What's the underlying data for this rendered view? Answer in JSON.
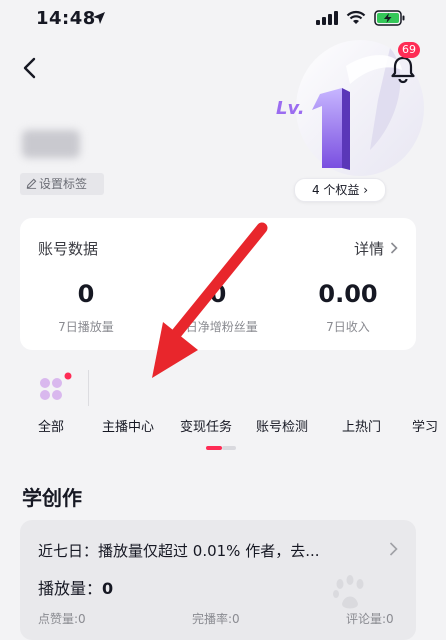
{
  "status_bar": {
    "time": "14:48"
  },
  "header": {
    "notification_count": "69"
  },
  "level": {
    "label": "Lv.",
    "number": "1",
    "benefits_label": "4 个权益 ›"
  },
  "profile": {
    "set_tag_label": "设置标签"
  },
  "account_data": {
    "title": "账号数据",
    "detail_label": "详情",
    "metrics": [
      {
        "value": "0",
        "label": "7日播放量"
      },
      {
        "value": "0",
        "label": "7日净增粉丝量"
      },
      {
        "value": "0.00",
        "label": "7日收入"
      }
    ]
  },
  "tabs": [
    "全部",
    "主播中心",
    "变现任务",
    "账号检测",
    "上热门",
    "学习"
  ],
  "learn": {
    "title": "学创作",
    "card_headline": "近七日：播放量仅超过 0.01% 作者，去...",
    "plays_label": "播放量：",
    "plays_value": "0",
    "stats": [
      "点赞量:0",
      "完播率:0",
      "评论量:0"
    ]
  },
  "colors": {
    "accent": "#fe2c55",
    "arrow": "#e8262c",
    "level_purple": "#8b5cf6"
  }
}
